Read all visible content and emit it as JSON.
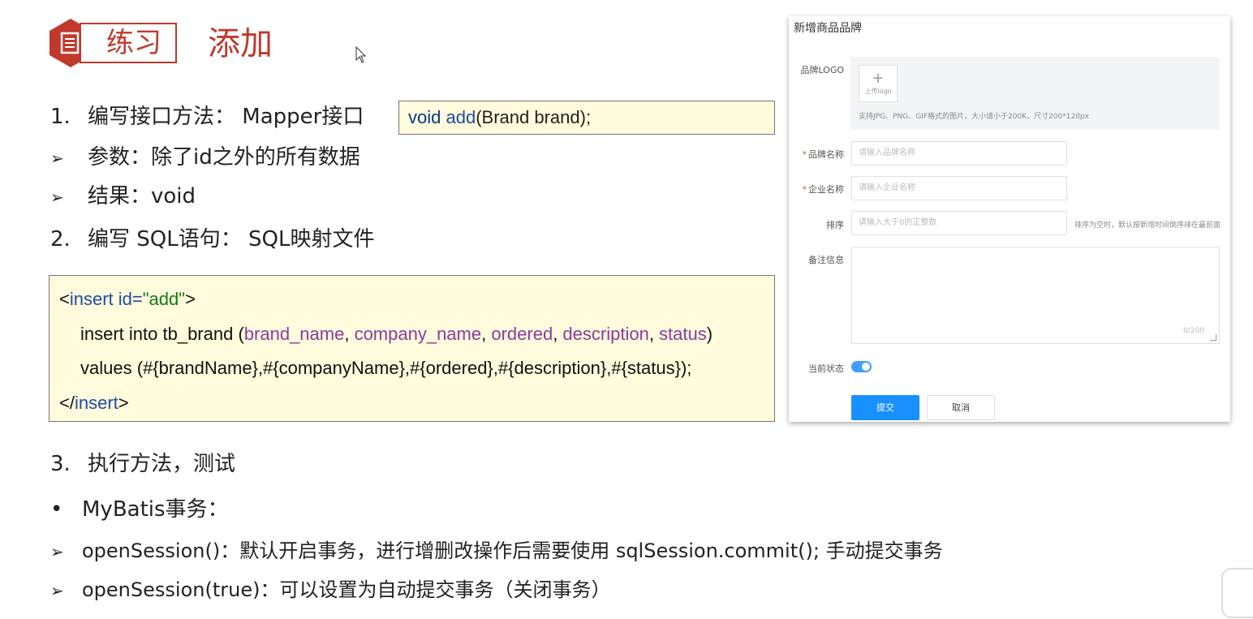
{
  "header": {
    "badge_label": "练习",
    "title": "添加",
    "badge_icon": "document-icon",
    "accent_color": "#c0392b"
  },
  "steps": {
    "step1": {
      "number": "1.",
      "text": "编写接口方法： Mapper接口"
    },
    "step1_code": {
      "kw": "void",
      "method": "add",
      "rest": "(Brand brand);"
    },
    "param_bullet": "➢",
    "param": "参数：除了id之外的所有数据",
    "result_bullet": "➢",
    "result": "结果：void",
    "step2": {
      "number": "2.",
      "text": "编写 SQL语句： SQL映射文件"
    },
    "step3": {
      "number": "3.",
      "text": "执行方法，测试"
    }
  },
  "sql_code": {
    "l1_open": "<",
    "l1_tag": "insert",
    "l1_attr": " id=",
    "l1_val": "\"add\"",
    "l1_close": ">",
    "l2_prefix": "insert into tb_brand (",
    "l2_col1": "brand_name",
    "l2_sep1": ", ",
    "l2_col2": "company_name",
    "l2_sep2": ", ",
    "l2_col3": "ordered",
    "l2_sep3": ", ",
    "l2_col4": "description",
    "l2_sep4": ", ",
    "l2_col5": "status",
    "l2_suffix": ")",
    "l3": "values (#{brandName},#{companyName},#{ordered},#{description},#{status});",
    "l4_open": "</",
    "l4_tag": "insert",
    "l4_close": ">"
  },
  "transaction": {
    "dot": "•",
    "heading": "MyBatis事务：",
    "item1_bullet": "➢",
    "item1": "openSession()：默认开启事务，进行增删改操作后需要使用 sqlSession.commit(); 手动提交事务",
    "item2_bullet": "➢",
    "item2": "openSession(true)：可以设置为自动提交事务（关闭事务）"
  },
  "form": {
    "title": "新增商品品牌",
    "logo_label": "品牌LOGO",
    "upload_plus": "+",
    "upload_caption": "上传logo",
    "upload_hint": "支持JPG、PNG、GIF格式的图片，大小请小于200K，尺寸200*120px",
    "required_mark": "*",
    "brand_label": "品牌名称",
    "brand_placeholder": "请输入品牌名称",
    "company_label": "企业名称",
    "company_placeholder": "请输入企业名称",
    "sort_label": "排序",
    "sort_placeholder": "请输入大于0的正整数",
    "sort_hint": "排序为空时，默认按新增时间倒序排在最前面",
    "desc_label": "备注信息",
    "desc_counter": "0/200",
    "status_label": "当前状态",
    "status_on": true,
    "submit_label": "提交",
    "cancel_label": "取消",
    "primary_color": "#1890ff"
  }
}
